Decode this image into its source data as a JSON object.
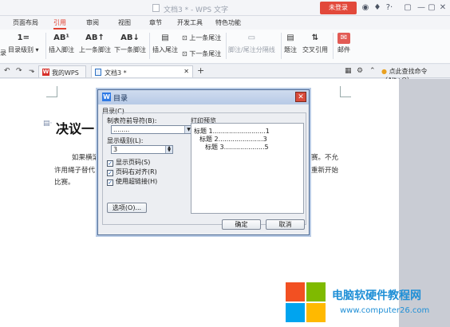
{
  "titlebar": {
    "doc_title": "文档3 * - WPS 文字",
    "login": "未登录",
    "win_controls": [
      "▢",
      "—",
      "▢",
      "✕"
    ]
  },
  "ribbon_tabs": [
    "页面布局",
    "引用",
    "审阅",
    "视图",
    "章节",
    "开发工具",
    "特色功能"
  ],
  "ribbon": {
    "toc_partial": "录",
    "toc_level": "目录级别",
    "insert_footnote": "插入脚注",
    "prev_footnote": "上一条脚注",
    "next_footnote": "下一条脚注",
    "insert_endnote": "插入尾注",
    "prev_endnote": "上一条尾注",
    "next_endnote": "下一条尾注",
    "footnote_separator": "脚注/尾注分隔线",
    "caption": "题注",
    "cross_ref": "交叉引用",
    "mail": "邮件"
  },
  "doc_tabs": {
    "wps_tab": "我的WPS",
    "doc_tab": "文档3 *",
    "add": "+",
    "search_cmd": "点此查找命令（Alt+Q）"
  },
  "document": {
    "heading": "决议一",
    "lines": [
      "如果横梁",
      "许用绳子替代",
      "比赛。",
      "赛。不允",
      "重新开始"
    ]
  },
  "dialog": {
    "title": "目录",
    "section": "目录(C)",
    "tab_leader_label": "制表符前导符(B):",
    "tab_leader_value": "........",
    "show_levels_label": "显示级别(L):",
    "show_levels_value": "3",
    "checkboxes": [
      "显示页码(S)",
      "页码右对齐(R)",
      "使用超链接(H)"
    ],
    "preview_label": "打印预览",
    "preview_lines": [
      "标题 1..........................1",
      "标题 2......................3",
      "标题 3....................5"
    ],
    "options_button": "选项(O)...",
    "ok_button": "确定",
    "cancel_button": "取消"
  },
  "watermark": {
    "text": "电脑软硬件教程网",
    "url": "www.computer26.com"
  },
  "colors": {
    "accent_red": "#e04030",
    "dialog_border": "#4e6c96",
    "watermark_blue": "#1f8fd6"
  }
}
